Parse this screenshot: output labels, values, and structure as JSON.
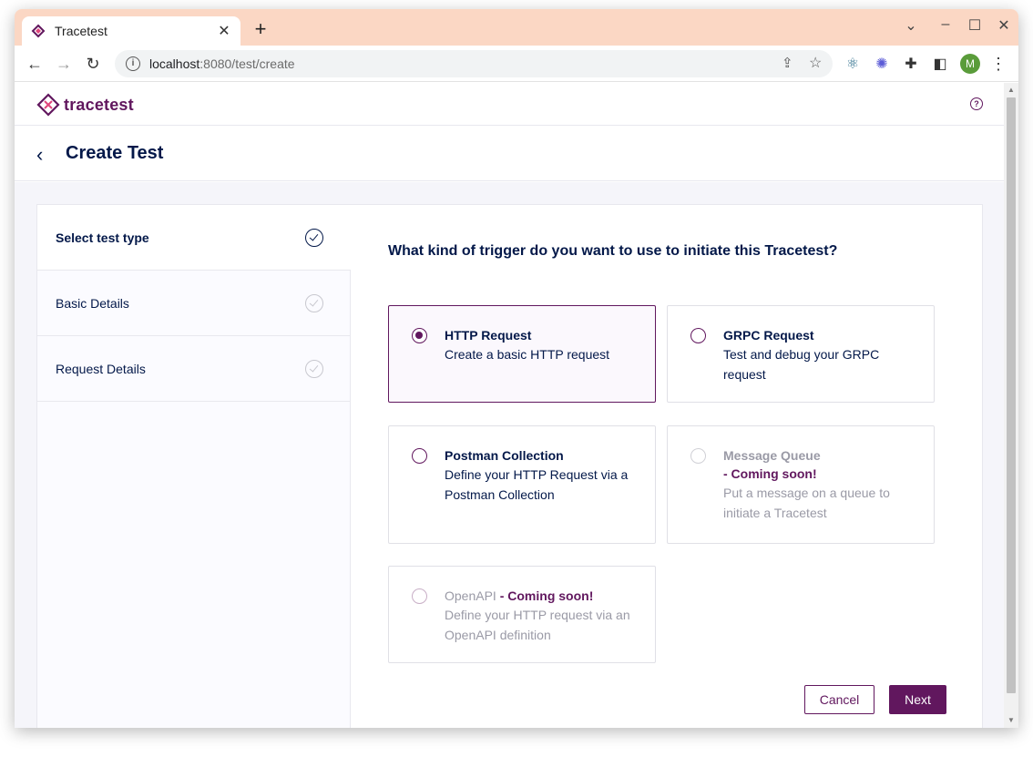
{
  "browser": {
    "tab_title": "Tracetest",
    "url_host": "localhost",
    "url_path": ":8080/test/create",
    "avatar_letter": "M"
  },
  "app": {
    "logo_text": "tracetest",
    "page_title": "Create Test",
    "brand_color": "#61175e",
    "text_color": "#031849"
  },
  "steps": [
    {
      "label": "Select test type",
      "state": "active"
    },
    {
      "label": "Basic Details",
      "state": "pending"
    },
    {
      "label": "Request Details",
      "state": "pending"
    }
  ],
  "question": "What kind of trigger do you want to use to initiate this Tracetest?",
  "options": {
    "http": {
      "title": "HTTP Request",
      "desc": "Create a basic HTTP request",
      "selected": true
    },
    "grpc": {
      "title": "GRPC Request",
      "desc": "Test and debug your GRPC request"
    },
    "postman": {
      "title": "Postman Collection",
      "desc": "Define your HTTP Request via a Postman Collection"
    },
    "queue": {
      "title": "Message Queue",
      "soon": " - Coming soon!",
      "desc": "Put a message on a queue to initiate a Tracetest",
      "disabled": true
    },
    "openapi": {
      "title": "OpenAPI",
      "soon": " - Coming soon!",
      "desc": "Define your HTTP request via an OpenAPI definition",
      "disabled": true
    }
  },
  "buttons": {
    "cancel": "Cancel",
    "next": "Next"
  }
}
